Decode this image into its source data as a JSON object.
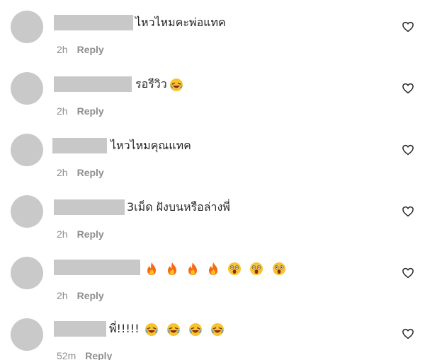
{
  "comments": [
    {
      "text": "ไหวไหมคะพ่อแทค",
      "time": "2h",
      "reply": "Reply",
      "emojis": []
    },
    {
      "text": "รอรีวิว",
      "time": "2h",
      "reply": "Reply",
      "emojis": [
        "laughing-emoji"
      ]
    },
    {
      "text": "ไหวไหมคุณแทค",
      "time": "2h",
      "reply": "Reply",
      "emojis": []
    },
    {
      "text": "3เม็ด ฝังบนหรือล่างพี่",
      "time": "2h",
      "reply": "Reply",
      "emojis": []
    },
    {
      "text": "",
      "time": "2h",
      "reply": "Reply",
      "emojis": [
        "fire-emoji",
        "fire-emoji",
        "fire-emoji",
        "fire-emoji",
        "astonished-emoji",
        "astonished-emoji",
        "astonished-emoji"
      ]
    },
    {
      "text": "พี่!!!!!",
      "time": "52m",
      "reply": "Reply",
      "emojis": [
        "laughing-emoji",
        "laughing-emoji",
        "laughing-emoji",
        "laughing-emoji"
      ]
    }
  ],
  "icons": {
    "like": "heart-outline-icon"
  },
  "colors": {
    "avatar": "#c9c9c9",
    "redacted_name": "#c8c8c8",
    "meta_text": "#8e8e8e",
    "text": "#262626"
  }
}
